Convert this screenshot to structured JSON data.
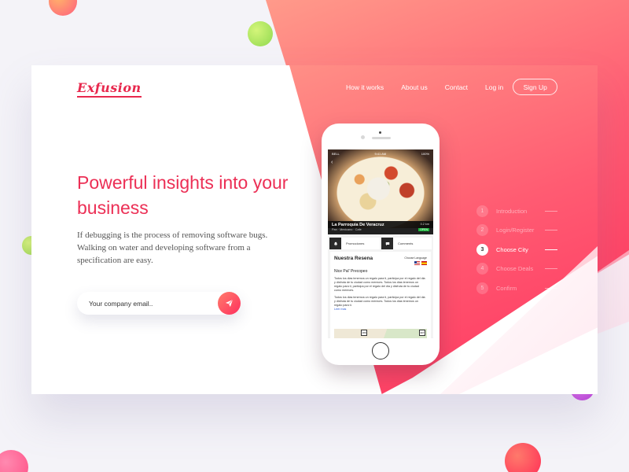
{
  "brand": {
    "logo_text": "Exfusion",
    "accent": "#e8284d"
  },
  "nav": {
    "links": [
      "How it works",
      "About us",
      "Contact"
    ],
    "login": "Log in",
    "signup": "Sign Up"
  },
  "hero": {
    "headline": "Powerful insights into your business",
    "description": "If debugging is the process of removing software bugs. Walking on water and developing software from a specification are easy.",
    "email_placeholder": "Your company email..",
    "send_icon": "paper-plane-icon"
  },
  "phone": {
    "status_left": "BELL",
    "status_time": "9:41 AM",
    "status_battery": "100%",
    "restaurant_name": "La Parroquia De Veracruz",
    "restaurant_sub": "Pan · Mexicano · Cafe",
    "distance": "0.2 km",
    "badge": "OPEN",
    "tabs": [
      "Promociones",
      "Comments"
    ],
    "review_title": "Nuestra Resena",
    "choose_language": "Choose Language",
    "review_subtitle": "Nice Pal' Precopeo",
    "review_p1": "Todos los dias tenemos un regalo para ti, participa por el regalo del dia y disfruta de tu ciudad como mereces. Todos los dias tenemos un regalo para ti, participa por el regalo del dia y disfruta de tu ciudad como mereces.",
    "review_p2": "Todos los dias tenemos un regalo para ti, participa por el regalo del dia y disfruta de tu ciudad como mereces. Todos los dias tenemos un regalo para ti.",
    "read_more": "Leer mas",
    "map_sign_1": "180",
    "map_sign_2": "307"
  },
  "steps": [
    {
      "num": "1",
      "label": "Introduction",
      "active": false
    },
    {
      "num": "2",
      "label": "Login/Register",
      "active": false
    },
    {
      "num": "3",
      "label": "Choose City",
      "active": true
    },
    {
      "num": "4",
      "label": "Choose Deals",
      "active": false
    },
    {
      "num": "5",
      "label": "Confirm",
      "active": false
    }
  ]
}
